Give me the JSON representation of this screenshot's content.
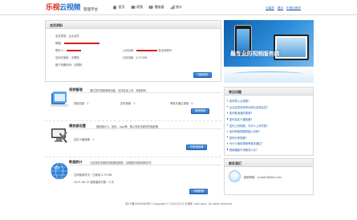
{
  "header": {
    "logo_part1": "乐视",
    "logo_part2": "云视频",
    "logo_subtitle": "管理平台",
    "nav": [
      {
        "label": "首页",
        "icon": "home-icon"
      },
      {
        "label": "视频",
        "icon": "video-icon"
      },
      {
        "label": "播放器",
        "icon": "player-icon"
      },
      {
        "label": "统计",
        "icon": "stats-icon"
      }
    ],
    "user_links": [
      "云端总",
      "退出",
      "乐视云首页"
    ]
  },
  "account": {
    "title": "会员资料",
    "member_type_label": "会员类型：",
    "member_type_value": "企业会员",
    "email_label": "邮箱：",
    "name_label": "联系人：",
    "company_label": "公司名称：",
    "license_label": "营业执照号",
    "used_space_label": "空间已使用：",
    "used_space_value": "无限制",
    "used_traffic_label": "已用流量：",
    "used_traffic_value": "0.73 MB",
    "expire_label": "账户到期时间：",
    "expire_value": "无限制",
    "details_button": "详细资料"
  },
  "banner": {
    "text": "最专业的视频服务商"
  },
  "video_mgmt": {
    "title": "视频管理",
    "desc": "通过您的视频管理功能，支持批量上传，快速转码",
    "row1_label": "视频总数：",
    "row1_value": "1",
    "row2_label": "发布视频：",
    "row2_value": "1",
    "row3_label": "审核未通过视频：",
    "row3_value": "0",
    "button": "管理视频"
  },
  "player_settings": {
    "title": "播放器设置",
    "desc": "播放器大小、颜色、logo等，随心所欲设置您的播放器",
    "row1_label": "自定义播放器：",
    "row1_value": "1",
    "button": "设置播放器"
  },
  "data_stats": {
    "title": "数据统计",
    "desc": "为您提供详细的视频播放数据，定期推送视频观看情况",
    "row1_label": "空间使用情况：",
    "row1_value": "已使用 0.73 MB",
    "row2_date": "2013-08-15",
    "row2_label": "视频播放次数：",
    "row2_value": "0 次",
    "button": "详细数据"
  },
  "faq": {
    "title": "常见问题",
    "items": [
      "如何导入云视频？",
      "企业会员如何申请成为优质会员？",
      "如何取消我的视频？",
      "如何自定义播放器？",
      "如何上传视频，为什么上传失败？",
      "如何获取视频的嵌入代码？",
      "如何分享视频？",
      "为什么我的视频审核未通过？",
      "视频播放不流畅怎么办？"
    ]
  },
  "contact": {
    "title": "联系我们",
    "text": "客服邮箱：yunkefu@letv.com"
  },
  "footer": {
    "text": "京ICP备09045969号-7 Copyright © 2004-2013 乐视网（letv.com）All rights reserved"
  }
}
